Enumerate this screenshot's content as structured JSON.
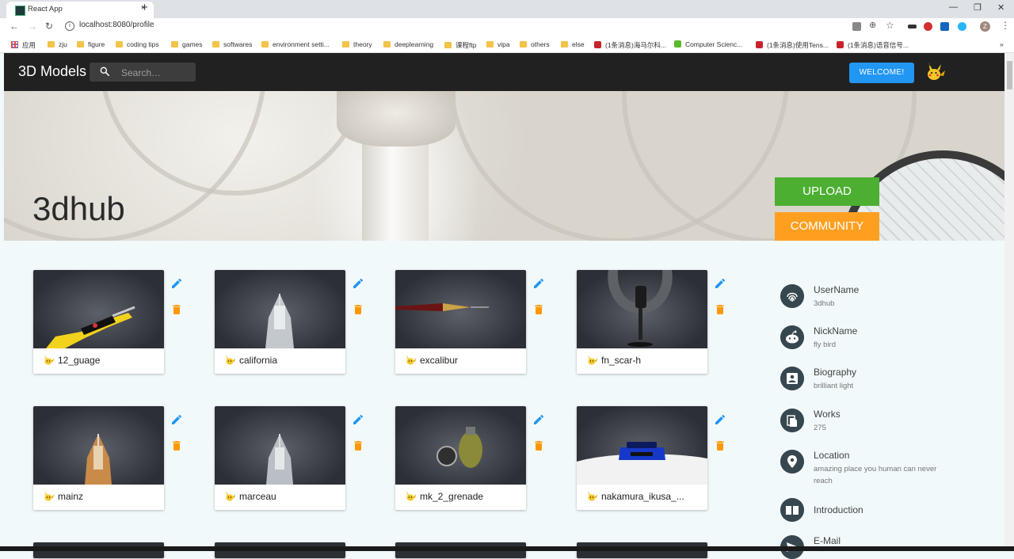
{
  "browser": {
    "tab_title": "React App",
    "tab_close": "×",
    "new_tab": "+",
    "url": "localhost:8080/profile",
    "win_min": "—",
    "win_restore": "❐",
    "win_close": "✕",
    "avatar_letter": "Z",
    "bookmarks": [
      "应用",
      "zju",
      "figure",
      "coding tips",
      "games",
      "softwares",
      "environment setti...",
      "theory",
      "deeplearning",
      "课程ftp",
      "vipa",
      "others",
      "else",
      "(1条消息)海马尔科...",
      "Computer Scienc...",
      "(1条消息)使用Tens...",
      "(1条消息)语音信号..."
    ],
    "bookmarks_more": "»"
  },
  "appbar": {
    "brand": "3D Models",
    "search_placeholder": "Search…",
    "welcome_label": "WELCOME!"
  },
  "hero": {
    "title": "3dhub",
    "upload_label": "UPLOAD",
    "community_label": "COMMUNITY"
  },
  "models": [
    {
      "name": "12_guage"
    },
    {
      "name": "california"
    },
    {
      "name": "excalibur"
    },
    {
      "name": "fn_scar-h"
    },
    {
      "name": "mainz"
    },
    {
      "name": "marceau"
    },
    {
      "name": "mk_2_grenade"
    },
    {
      "name": "nakamura_ikusa_..."
    }
  ],
  "profile": [
    {
      "title": "UserName",
      "value": "3dhub",
      "icon": "fingerprint-icon"
    },
    {
      "title": "NickName",
      "value": "fly bird",
      "icon": "reddit-icon"
    },
    {
      "title": "Biography",
      "value": "brilliant light",
      "icon": "contact-card-icon"
    },
    {
      "title": "Works",
      "value": "275",
      "icon": "file-copy-icon"
    },
    {
      "title": "Location",
      "value": "amazing place you human can never reach",
      "icon": "location-pin-icon"
    },
    {
      "title": "Introduction",
      "value": "",
      "icon": "book-icon"
    },
    {
      "title": "E-Mail",
      "value": "",
      "icon": "send-icon"
    }
  ],
  "colors": {
    "appbar": "#212121",
    "welcome": "#2196f3",
    "upload": "#4caf32",
    "community": "#ff9f20",
    "edit": "#2196f3",
    "delete": "#ff9800",
    "page_bg": "#f1f9fb"
  }
}
